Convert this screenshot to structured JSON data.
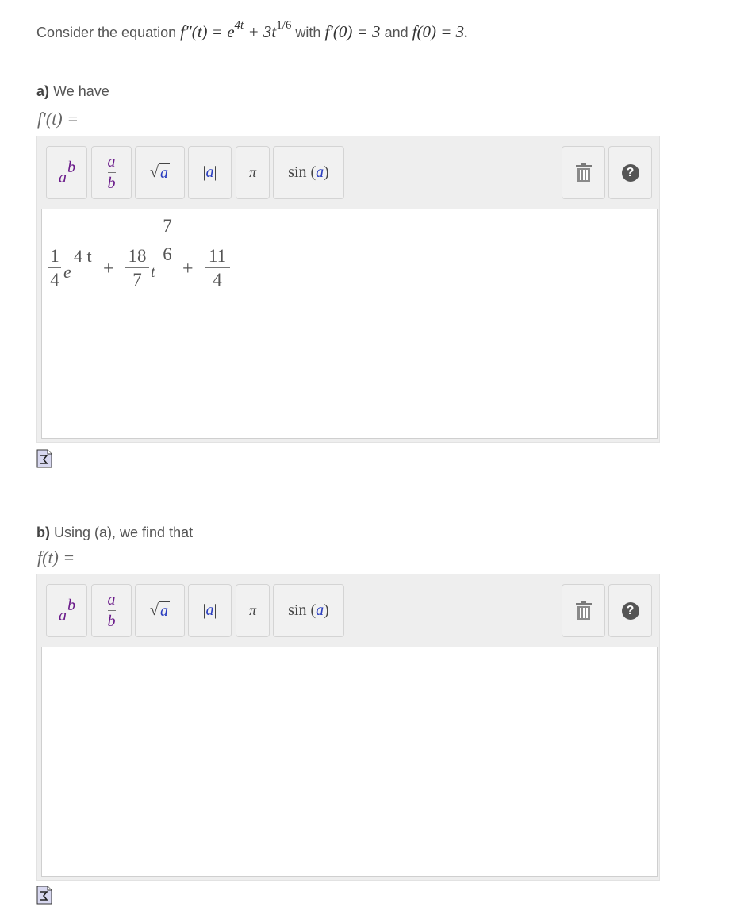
{
  "question": {
    "prefix": "Consider the equation",
    "equation_lhs": "f″(t) = e",
    "exp1": "4t",
    "plus": " + 3t",
    "exp2": "1/6",
    "with": "with",
    "cond1": "f′(0) = 3",
    "and": "and",
    "cond2": "f(0) = 3."
  },
  "part_a": {
    "letter": "a)",
    "text": "We have",
    "lhs": "f′(t) =",
    "answer": {
      "t1_num": "1",
      "t1_den": "4",
      "t1_base": "e",
      "t1_exp": "4 t",
      "op1": "+",
      "t2_num": "18",
      "t2_den": "7",
      "t2_base": "t",
      "t2_exp_num": "7",
      "t2_exp_den": "6",
      "op2": "+",
      "t3_num": "11",
      "t3_den": "4"
    }
  },
  "part_b": {
    "letter": "b)",
    "text": "Using (a), we find that",
    "lhs": "f(t) =",
    "answer": ""
  },
  "toolbar": {
    "power_base": "a",
    "power_exp": "b",
    "frac_num": "a",
    "frac_den": "b",
    "sqrt_symbol": "√",
    "sqrt_arg": "a",
    "abs_label": "|a|",
    "abs_arg": "a",
    "pi_label": "π",
    "sin_label": "sin",
    "sin_arg": "a",
    "trash_icon": "trash-icon",
    "help_label": "?"
  },
  "colors": {
    "toolbar_bg": "#eeeeee",
    "button_bg": "#f1f1f1",
    "variable_blue": "#2a3ec0",
    "variable_purple": "#6a1a8a",
    "help_circle": "#555555"
  }
}
